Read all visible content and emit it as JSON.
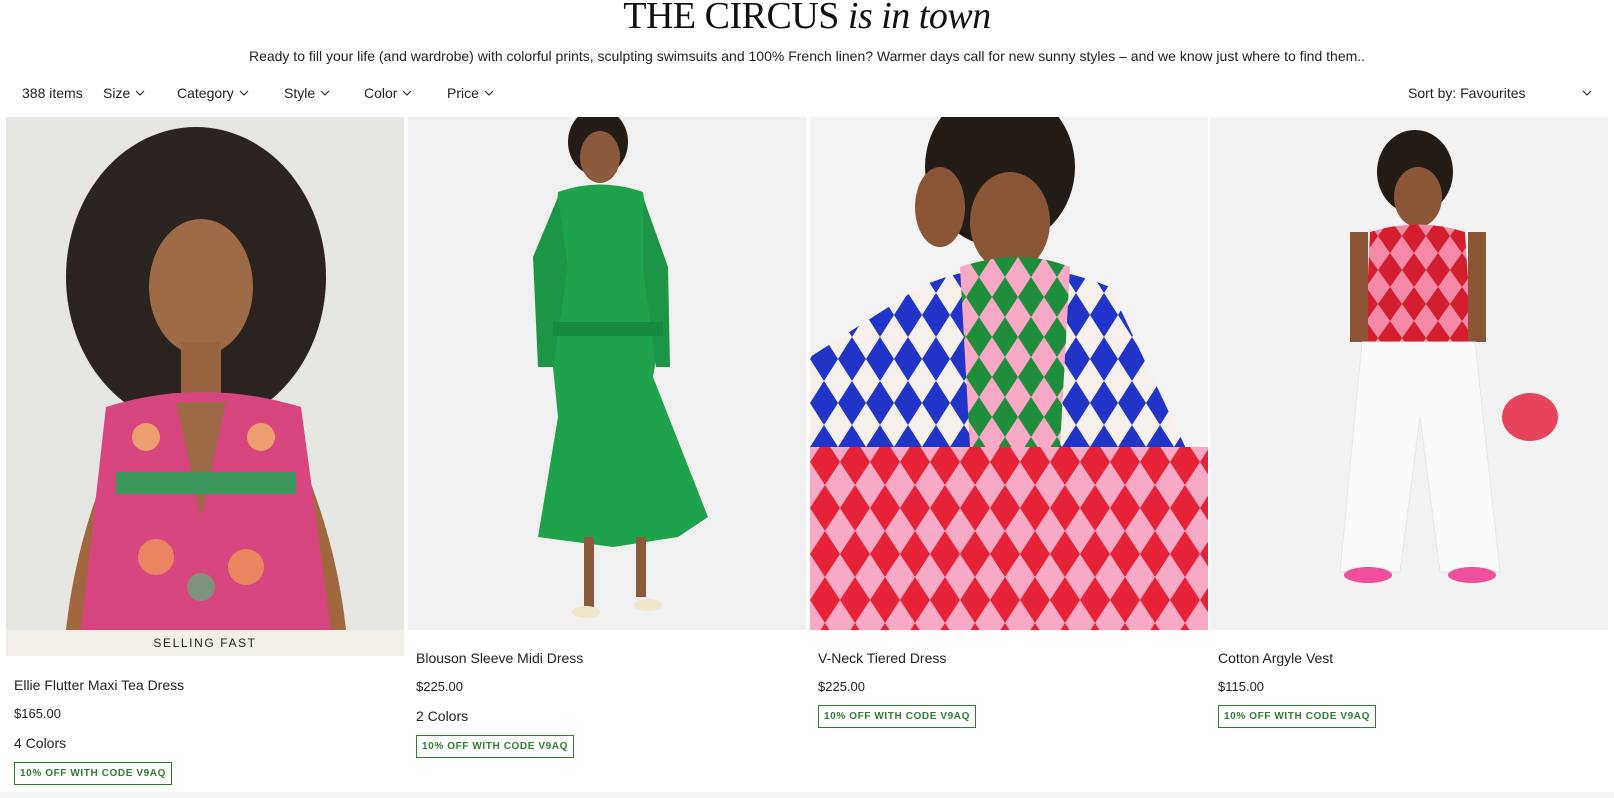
{
  "hero": {
    "title_main": "THE CIRCUS",
    "title_italic": "is in town",
    "subtitle": "Ready to fill your life (and wardrobe) with colorful prints, sculpting swimsuits and 100% French linen? Warmer days call for new sunny styles – and we know just where to find them.."
  },
  "filters": {
    "item_count": "388 items",
    "items": [
      {
        "label": "Size"
      },
      {
        "label": "Category"
      },
      {
        "label": "Style"
      },
      {
        "label": "Color"
      },
      {
        "label": "Price"
      }
    ],
    "sort_label": "Sort by: Favourites"
  },
  "products": [
    {
      "name": "Ellie Flutter Maxi Tea Dress",
      "price": "$165.00",
      "badge": "SELLING FAST",
      "colors": "4 Colors",
      "promo": "10% OFF WITH CODE V9AQ",
      "icon": "dress-photo"
    },
    {
      "name": "Blouson Sleeve Midi Dress",
      "price": "$225.00",
      "colors": "2 Colors",
      "promo": "10% OFF WITH CODE V9AQ",
      "icon": "dress-photo"
    },
    {
      "name": "V-Neck Tiered Dress",
      "price": "$225.00",
      "promo": "10% OFF WITH CODE V9AQ",
      "icon": "dress-photo"
    },
    {
      "name": "Cotton Argyle Vest",
      "price": "$115.00",
      "promo": "10% OFF WITH CODE V9AQ",
      "icon": "vest-photo"
    }
  ],
  "colors": {
    "promo_green": "#2f7d32",
    "badge_bg": "#f2efe8",
    "dress_pink": "#e0509a",
    "dress_green": "#1fa34a",
    "argyle_blue": "#2134c8",
    "argyle_red": "#e62336"
  }
}
